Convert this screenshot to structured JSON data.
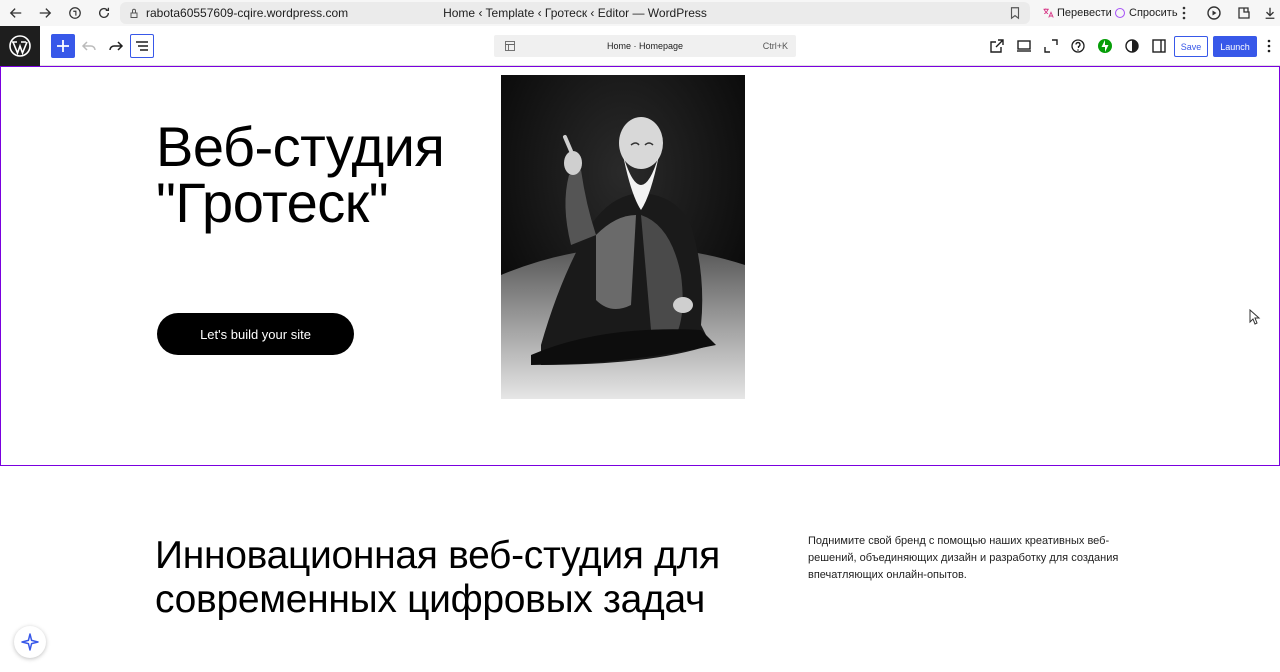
{
  "browser": {
    "url": "rabota60557609-cqire.wordpress.com",
    "title": "Home ‹ Template ‹ Гротеск ‹ Editor — WordPress",
    "translate_label": "Перевести",
    "ask_label": "Спросить"
  },
  "toolbar": {
    "document_title": "Home · Homepage",
    "shortcut": "Ctrl+K",
    "save_label": "Save",
    "launch_label": "Launch",
    "accent_color": "#3858e9"
  },
  "hero": {
    "title": "Веб-студия \"Гротеск\"",
    "cta_label": "Let's build your site",
    "photo": "black-and-white-portrait-of-smiling-elder-in-kimono"
  },
  "section": {
    "title": "Инновационная веб-студия для современных цифровых задач",
    "description": "Поднимите свой бренд с помощью наших креативных веб-решений, объединяющих дизайн и разработку для создания впечатляющих онлайн-опытов."
  },
  "colors": {
    "selection_border": "#7a00df",
    "wp_logo_bg": "#1e1e1e",
    "button_bg": "#000000"
  }
}
